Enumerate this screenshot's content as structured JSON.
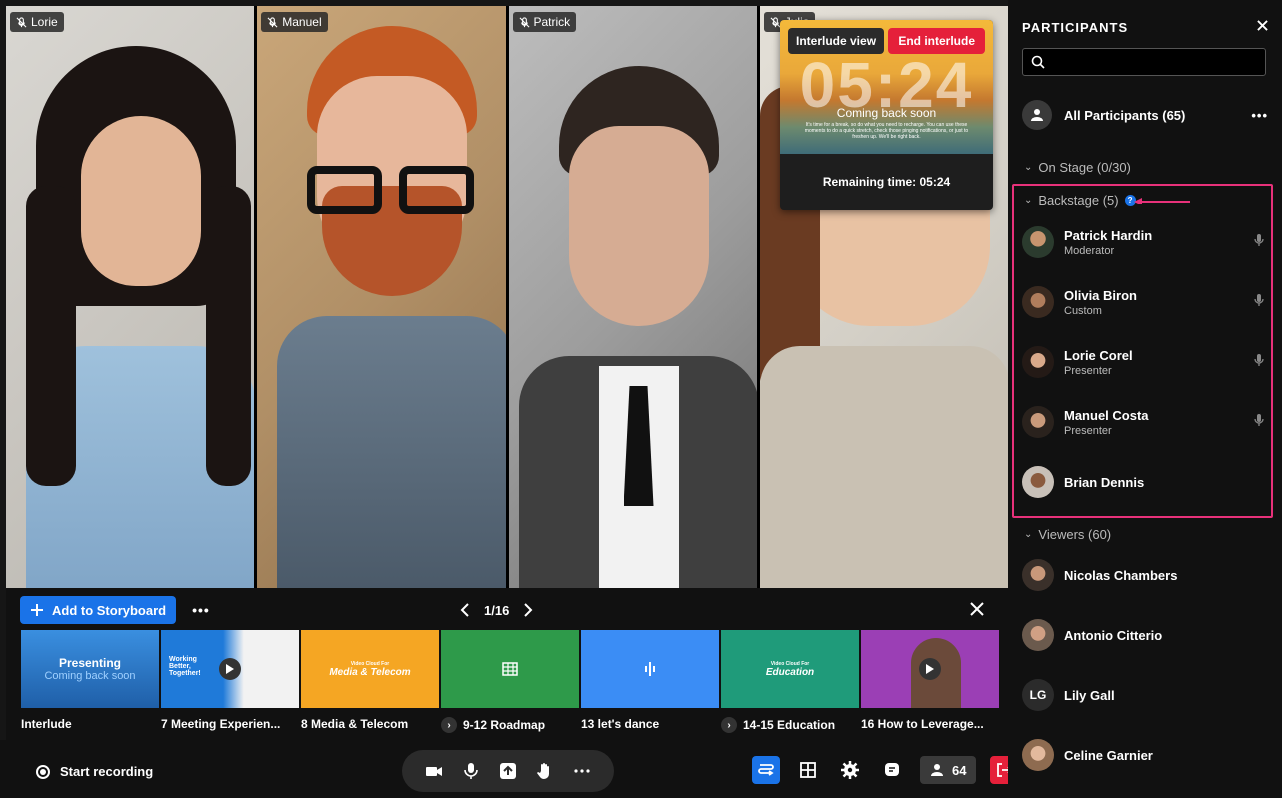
{
  "stage": {
    "tiles": [
      {
        "name": "Lorie"
      },
      {
        "name": "Manuel"
      },
      {
        "name": "Patrick"
      },
      {
        "name": "Julia"
      }
    ]
  },
  "interlude": {
    "view_label": "Interlude view",
    "end_label": "End interlude",
    "big_time": "05:24",
    "coming_back": "Coming back soon",
    "small_text": "It's time for a break, so do what you need to recharge. You can use these moments to do a quick stretch, check those pinging notifications, or just to freshen up. We'll be right back.",
    "remaining": "Remaining time: 05:24"
  },
  "storyboard": {
    "add_label": "Add to Storyboard",
    "more_label": "•••",
    "page": "1/16",
    "thumbs": [
      {
        "label": "Interlude",
        "img_title": "Presenting",
        "img_sub": "Coming back soon",
        "color": "#2e7fd0"
      },
      {
        "label": "7 Meeting Experien...",
        "img_title": "Working Better, Together!",
        "color": "#f2c230"
      },
      {
        "label": "8 Media & Telecom",
        "img_title": "Media & Telecom",
        "img_sub": "Video Cloud For",
        "color": "#f5a623"
      },
      {
        "label": "9-12 Roadmap",
        "color": "#2e9a4a",
        "has_chevron": true
      },
      {
        "label": "13 let's dance",
        "color": "#3b8df5"
      },
      {
        "label": "14-15 Education",
        "img_title": "Education",
        "img_sub": "Video Cloud For",
        "color": "#1f9b7a",
        "has_chevron": true
      },
      {
        "label": "16 How to Leverage...",
        "color": "#9b3fb5"
      }
    ]
  },
  "bottom": {
    "record_label": "Start recording",
    "participants_count": "64"
  },
  "panel": {
    "title": "PARTICIPANTS",
    "all_participants": "All Participants (65)",
    "on_stage": "On Stage (0/30)",
    "backstage": "Backstage (5)",
    "viewers": "Viewers (60)",
    "backstage_people": [
      {
        "name": "Patrick Hardin",
        "role": "Moderator"
      },
      {
        "name": "Olivia Biron",
        "role": "Custom"
      },
      {
        "name": "Lorie Corel",
        "role": "Presenter"
      },
      {
        "name": "Manuel Costa",
        "role": "Presenter"
      },
      {
        "name": "Brian Dennis",
        "role": ""
      }
    ],
    "viewer_people": [
      {
        "name": "Nicolas Chambers"
      },
      {
        "name": "Antonio Citterio"
      },
      {
        "name": "Lily Gall",
        "initials": "LG"
      },
      {
        "name": "Celine Garnier"
      }
    ]
  },
  "colors": {
    "accent_blue": "#1a73e8",
    "danger_red": "#e5203a",
    "highlight_pink": "#e8317a"
  }
}
